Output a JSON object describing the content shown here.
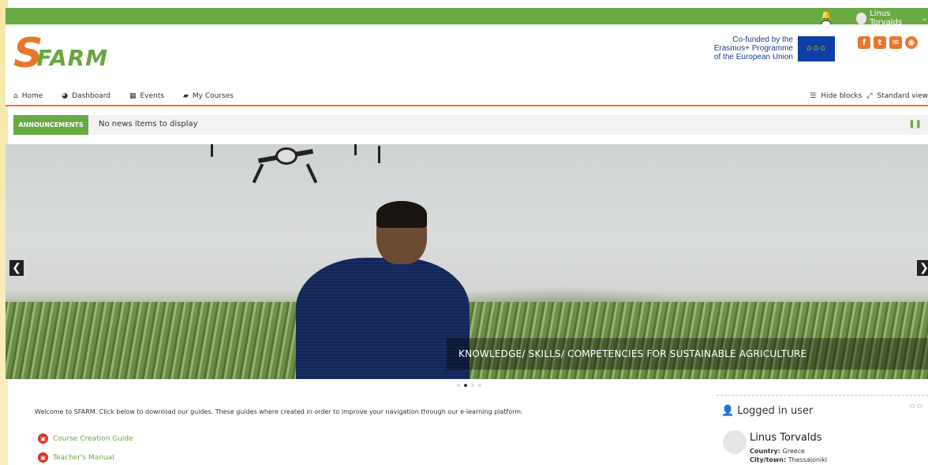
{
  "topbar": {
    "user_name": "Linus Torvalds",
    "user_caret": "⌄"
  },
  "header": {
    "logo_s": "S",
    "logo_rest": "FARM",
    "eu_line1": "Co-funded by the",
    "eu_line2": "Erasmus+ Programme",
    "eu_line3": "of the European Union"
  },
  "nav": {
    "items": [
      {
        "label": "Home",
        "icon": "home-icon"
      },
      {
        "label": "Dashboard",
        "icon": "dashboard-icon"
      },
      {
        "label": "Events",
        "icon": "calendar-icon"
      },
      {
        "label": "My Courses",
        "icon": "briefcase-icon"
      }
    ],
    "hide_blocks": "Hide blocks",
    "standard_view": "Standard view"
  },
  "announcements": {
    "label": "ANNOUNCEMENTS",
    "text": "No news items to display"
  },
  "slider": {
    "caption": "KNOWLEDGE/ SKILLS/ COMPETENCIES FOR SUSTAINABLE AGRICULTURE",
    "prev": "❮",
    "next": "❯",
    "dot_count": 4,
    "active_dot": 1
  },
  "main": {
    "welcome": "Welcome to SFARM. Click below to download our guides. These guides where created in order to improve your navigation through our e-learning platform.",
    "guides": [
      "Course Creation Guide",
      "Teacher's Manual"
    ]
  },
  "logged_in_block": {
    "title": "Logged in user",
    "name": "Linus Torvalds",
    "country_label": "Country:",
    "country": "Greece",
    "city_label": "City/town:",
    "city": "Thessaloniki"
  },
  "colors": {
    "brand_green": "#6aaa43",
    "brand_orange": "#e8772e"
  }
}
